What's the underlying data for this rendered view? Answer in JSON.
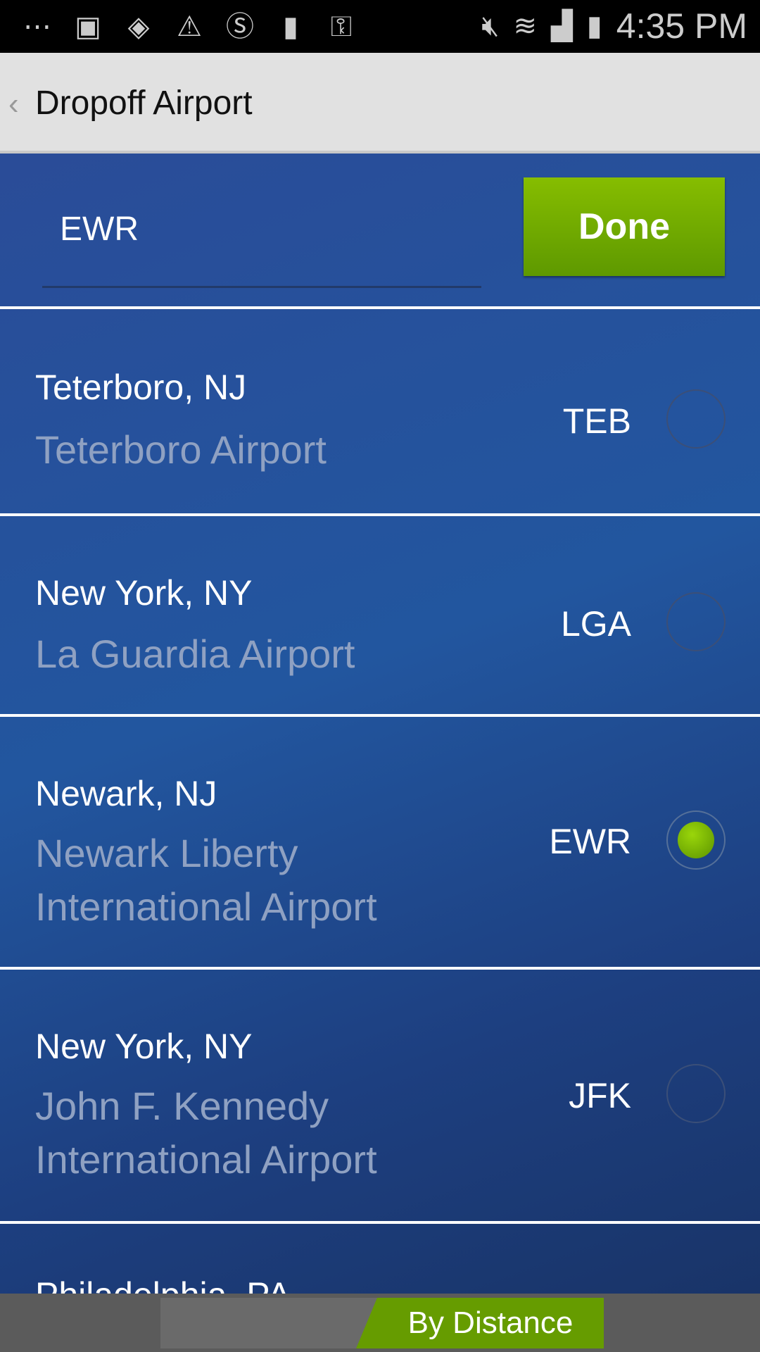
{
  "status_bar": {
    "time": "4:35 PM",
    "icons": [
      "messages-icon",
      "gallery-icon",
      "wifi-shield-icon",
      "warning-icon",
      "s-app-icon",
      "copy-icon",
      "tmobile-tag-icon",
      "mute-icon",
      "wifi-icon",
      "signal-icon",
      "battery-icon"
    ]
  },
  "header": {
    "title": "Dropoff Airport",
    "back_icon": "chevron-left-icon"
  },
  "search": {
    "value": "EWR",
    "done_label": "Done"
  },
  "airports": [
    {
      "city": "Teterboro, NJ",
      "name": "Teterboro Airport",
      "code": "TEB",
      "selected": false
    },
    {
      "city": "New York, NY",
      "name": "La Guardia Airport",
      "code": "LGA",
      "selected": false
    },
    {
      "city": "Newark, NJ",
      "name": "Newark Liberty International Airport",
      "code": "EWR",
      "selected": true
    },
    {
      "city": "New York, NY",
      "name": "John F. Kennedy International Airport",
      "code": "JFK",
      "selected": false
    },
    {
      "city": "Philadelphia, PA"
    }
  ],
  "sort": {
    "active_label": "By Distance"
  },
  "colors": {
    "accent": "#669c00",
    "header_bg": "#e1e1e1",
    "list_bg": "#22569f"
  }
}
